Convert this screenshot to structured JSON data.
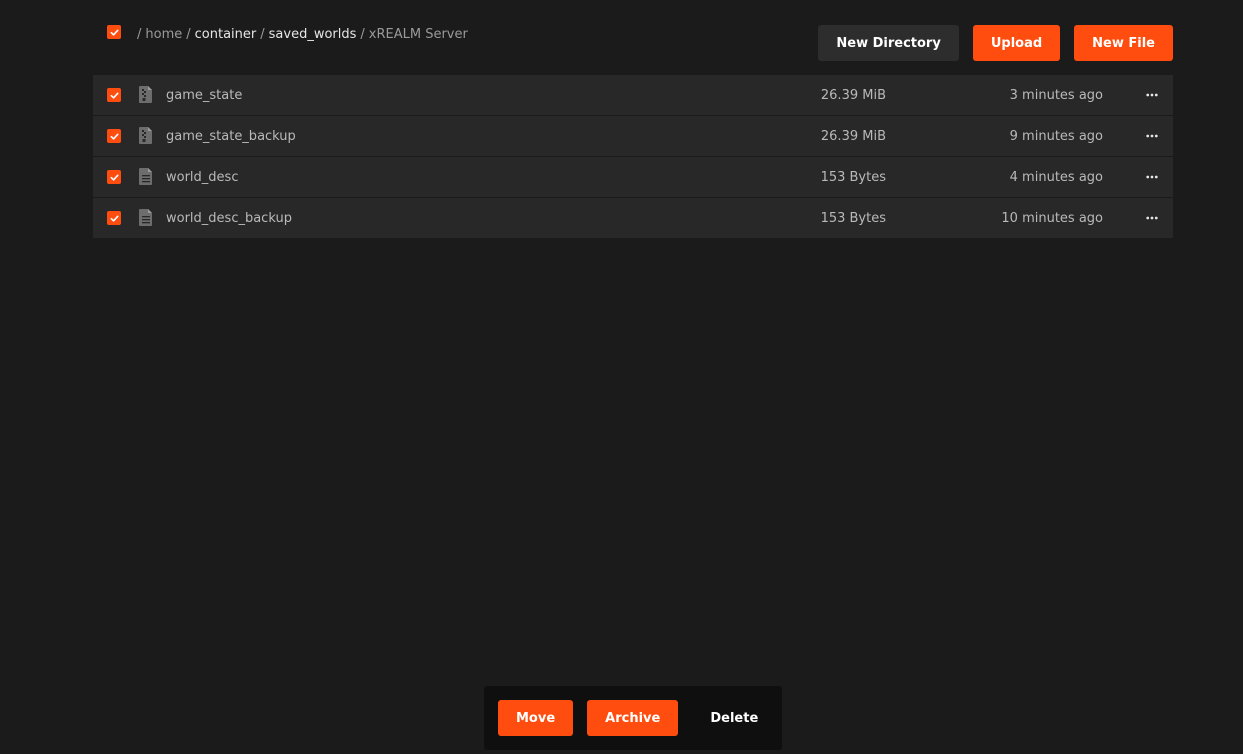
{
  "breadcrumb": {
    "sep": "/",
    "items": [
      {
        "label": "home",
        "style": "muted"
      },
      {
        "label": "container",
        "style": "link"
      },
      {
        "label": "saved_worlds",
        "style": "link"
      },
      {
        "label": "xREALM Server",
        "style": "current"
      }
    ]
  },
  "toolbar": {
    "new_directory_label": "New Directory",
    "upload_label": "Upload",
    "new_file_label": "New File"
  },
  "files": [
    {
      "name": "game_state",
      "size": "26.39 MiB",
      "modified": "3 minutes ago",
      "icon": "binary-file-icon"
    },
    {
      "name": "game_state_backup",
      "size": "26.39 MiB",
      "modified": "9 minutes ago",
      "icon": "binary-file-icon"
    },
    {
      "name": "world_desc",
      "size": "153 Bytes",
      "modified": "4 minutes ago",
      "icon": "text-file-icon"
    },
    {
      "name": "world_desc_backup",
      "size": "153 Bytes",
      "modified": "10 minutes ago",
      "icon": "text-file-icon"
    }
  ],
  "bulk_actions": {
    "move_label": "Move",
    "archive_label": "Archive",
    "delete_label": "Delete"
  },
  "colors": {
    "accent": "#ff4d0f",
    "background": "#1b1b1b",
    "row": "#282828"
  }
}
